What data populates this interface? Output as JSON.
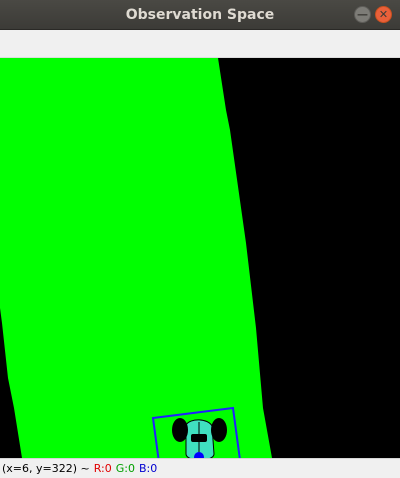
{
  "window": {
    "title": "Observation Space",
    "minimize_glyph": "—",
    "close_glyph": "✕"
  },
  "status": {
    "coords": "(x=6, y=322) ~",
    "r": "R:0",
    "g": "G:0",
    "b": "B:0"
  },
  "colors": {
    "track": "#00ff00",
    "background": "#000000",
    "car_body": "#40e0c0",
    "wheel": "#000000",
    "bounding_box": "#2020ff",
    "sensor": "#0000ff"
  }
}
